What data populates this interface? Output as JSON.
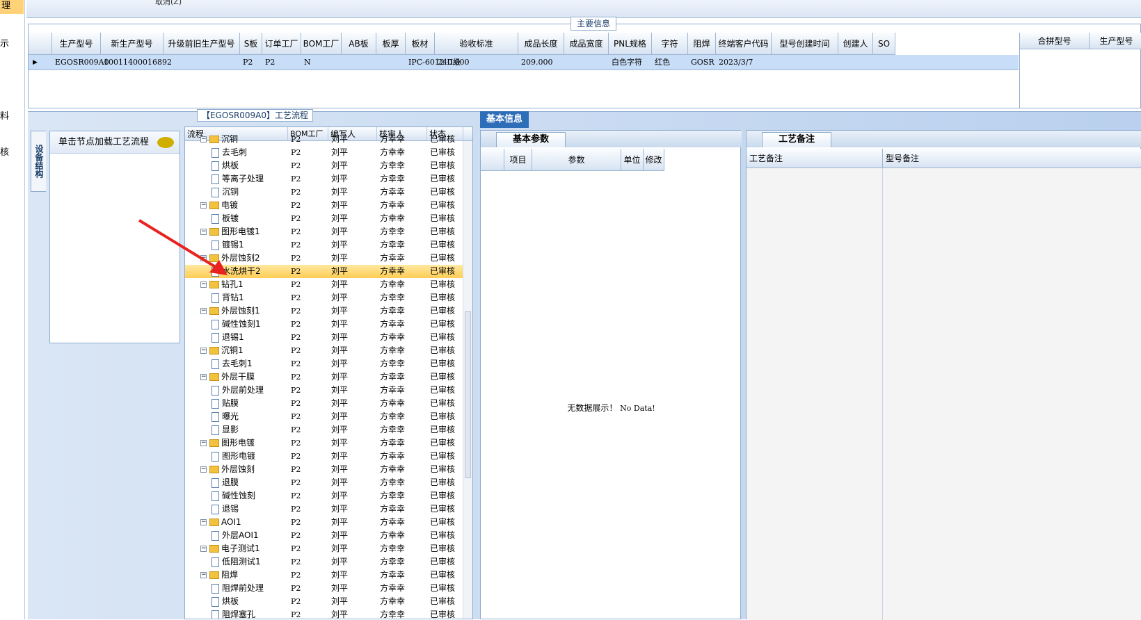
{
  "leftnav": {
    "selected": "理",
    "items": [
      "示",
      "料",
      "核"
    ]
  },
  "topbar": {
    "partial_text": "取消(Z)"
  },
  "main_info": {
    "label": "主要信息",
    "columns": [
      "生产型号",
      "新生产型号",
      "升级前旧生产型号",
      "S板",
      "订单工厂",
      "BOM工厂",
      "AB板",
      "板厚",
      "板材",
      "验收标准",
      "成品长度",
      "成品宽度",
      "PNL规格",
      "字符",
      "阻焊",
      "终端客户代码",
      "型号创建时间",
      "创建人",
      "SO"
    ],
    "row": {
      "生产型号": "EGOSR009A0",
      "新生产型号": "10011400016892",
      "升级前旧生产型号": "",
      "S板": "P2",
      "订单工厂": "P2",
      "BOM工厂": "N",
      "AB板": "",
      "板厚": "",
      "板材": "IPC-6012 II级",
      "验收标准": "240.000",
      "成品长度": "209.000",
      "成品宽度": "",
      "PNL规格": "白色字符",
      "字符": "红色",
      "阻焊": "GOSR",
      "终端客户代码": "2023/3/7",
      "型号创建时间": "",
      "创建人": "",
      "SO": ""
    },
    "right_columns": [
      "合拼型号",
      "生产型号"
    ]
  },
  "left_panel": {
    "vertical_tab": "设备结构",
    "header": "单击节点加载工艺流程"
  },
  "flow": {
    "label": "【EGOSR009A0】工艺流程",
    "columns": [
      "流程",
      "BOM工厂",
      "编写人",
      "核审人",
      "状态"
    ],
    "rows": [
      {
        "level": 1,
        "name": "沉铜",
        "partial": true
      },
      {
        "level": 2,
        "name": "去毛刺"
      },
      {
        "level": 2,
        "name": "烘板"
      },
      {
        "level": 2,
        "name": "等离子处理"
      },
      {
        "level": 2,
        "name": "沉铜"
      },
      {
        "level": 1,
        "name": "电镀"
      },
      {
        "level": 2,
        "name": "板镀"
      },
      {
        "level": 1,
        "name": "图形电镀1"
      },
      {
        "level": 2,
        "name": "镀锡1"
      },
      {
        "level": 1,
        "name": "外层蚀刻2"
      },
      {
        "level": 2,
        "name": "水洗烘干2",
        "selected": true
      },
      {
        "level": 1,
        "name": "钻孔1"
      },
      {
        "level": 2,
        "name": "背钻1"
      },
      {
        "level": 1,
        "name": "外层蚀刻1"
      },
      {
        "level": 2,
        "name": "碱性蚀刻1"
      },
      {
        "level": 2,
        "name": "退锡1"
      },
      {
        "level": 1,
        "name": "沉铜1"
      },
      {
        "level": 2,
        "name": "去毛刺1"
      },
      {
        "level": 1,
        "name": "外层干膜"
      },
      {
        "level": 2,
        "name": "外层前处理"
      },
      {
        "level": 2,
        "name": "贴膜"
      },
      {
        "level": 2,
        "name": "曝光"
      },
      {
        "level": 2,
        "name": "显影"
      },
      {
        "level": 1,
        "name": "图形电镀"
      },
      {
        "level": 2,
        "name": "图形电镀"
      },
      {
        "level": 1,
        "name": "外层蚀刻"
      },
      {
        "level": 2,
        "name": "退膜"
      },
      {
        "level": 2,
        "name": "碱性蚀刻"
      },
      {
        "level": 2,
        "name": "退锡"
      },
      {
        "level": 1,
        "name": "AOI1"
      },
      {
        "level": 2,
        "name": "外层AOI1"
      },
      {
        "level": 1,
        "name": "电子测试1"
      },
      {
        "level": 2,
        "name": "低阻测试1"
      },
      {
        "level": 1,
        "name": "阻焊"
      },
      {
        "level": 2,
        "name": "阻焊前处理"
      },
      {
        "level": 2,
        "name": "烘板"
      },
      {
        "level": 2,
        "name": "阻焊塞孔"
      }
    ],
    "bom": "P2",
    "writer": "刘平",
    "reviewer": "方幸幸",
    "status": "已审核"
  },
  "basic_info": {
    "tab": "基本信息",
    "sub_tab": "基本参数",
    "columns": [
      "项目",
      "参数",
      "单位",
      "修改"
    ],
    "empty_text_cn": "无数据展示！",
    "empty_text_en": "No Data!"
  },
  "remarks": {
    "tab": "工艺备注",
    "columns": [
      "工艺备注",
      "型号备注"
    ]
  },
  "colors": {
    "accent": "#2e6db8",
    "selected_row": "#c8ddf7",
    "tree_selected": "#ffcd55",
    "panel_bg": "#b9d0ee"
  }
}
